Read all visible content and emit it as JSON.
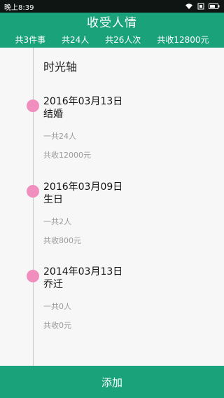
{
  "status_bar": {
    "time": "晚上8:39"
  },
  "header": {
    "title": "收受人情",
    "stats": [
      {
        "label": "共3件事"
      },
      {
        "label": "共24人"
      },
      {
        "label": "共26人次"
      },
      {
        "label": "共收12800元"
      }
    ]
  },
  "timeline": {
    "title": "时光轴",
    "events": [
      {
        "date": "2016年03月13日",
        "name": "结婚",
        "people": "一共24人",
        "amount": "共收12000元"
      },
      {
        "date": "2016年03月09日",
        "name": "生日",
        "people": "一共2人",
        "amount": "共收800元"
      },
      {
        "date": "2014年03月13日",
        "name": "乔迁",
        "people": "一共0人",
        "amount": "共收0元"
      }
    ]
  },
  "footer": {
    "add_label": "添加"
  },
  "colors": {
    "primary": "#1aa37a",
    "timeline_dot": "#f08fbe",
    "status_bar": "#0f1512"
  }
}
